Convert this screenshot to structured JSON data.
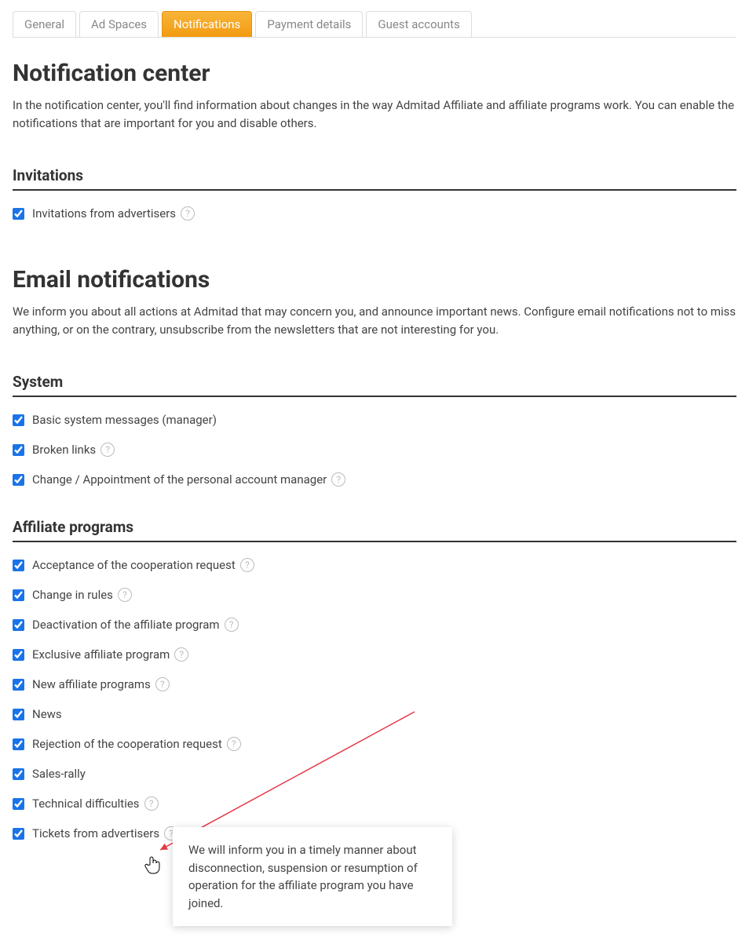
{
  "tabs": [
    {
      "label": "General",
      "active": false
    },
    {
      "label": "Ad Spaces",
      "active": false
    },
    {
      "label": "Notifications",
      "active": true
    },
    {
      "label": "Payment details",
      "active": false
    },
    {
      "label": "Guest accounts",
      "active": false
    }
  ],
  "page": {
    "title": "Notification center",
    "intro": "In the notification center, you'll find information about changes in the way Admitad Affiliate and affiliate programs work. You can enable the notifications that are important for you and disable others."
  },
  "sections": {
    "invitations": {
      "heading": "Invitations",
      "items": [
        {
          "label": "Invitations from advertisers",
          "help": true,
          "checked": true
        }
      ]
    },
    "email_notifications": {
      "title": "Email notifications",
      "intro": "We inform you about all actions at Admitad that may concern you, and announce important news. Configure email notifications not to miss anything, or on the contrary, unsubscribe from the newsletters that are not interesting for you."
    },
    "system": {
      "heading": "System",
      "items": [
        {
          "label": "Basic system messages (manager)",
          "help": false,
          "checked": true
        },
        {
          "label": "Broken links",
          "help": true,
          "checked": true
        },
        {
          "label": "Change / Appointment of the personal account manager",
          "help": true,
          "checked": true
        }
      ]
    },
    "affiliate_programs": {
      "heading": "Affiliate programs",
      "items": [
        {
          "label": "Acceptance of the cooperation request",
          "help": true,
          "checked": true
        },
        {
          "label": "Change in rules",
          "help": true,
          "checked": true
        },
        {
          "label": "Deactivation of the affiliate program",
          "help": true,
          "checked": true
        },
        {
          "label": "Exclusive affiliate program",
          "help": true,
          "checked": true
        },
        {
          "label": "New affiliate programs",
          "help": true,
          "checked": true
        },
        {
          "label": "News",
          "help": false,
          "checked": true
        },
        {
          "label": "Rejection of the cooperation request",
          "help": true,
          "checked": true
        },
        {
          "label": "Sales-rally",
          "help": false,
          "checked": true
        },
        {
          "label": "Technical difficulties",
          "help": true,
          "checked": true
        },
        {
          "label": "Tickets from advertisers",
          "help": true,
          "checked": true
        }
      ]
    }
  },
  "tooltip": {
    "text": "We will inform you in a timely manner about disconnection, suspension or resumption of operation for the affiliate program you have joined."
  }
}
